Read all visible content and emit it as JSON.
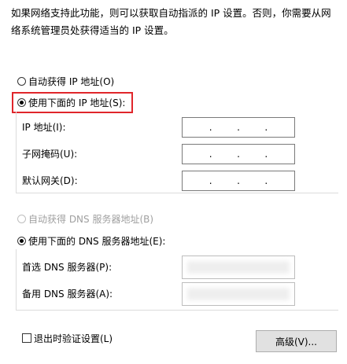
{
  "description": "如果网络支持此功能，则可以获取自动指派的 IP 设置。否则，你需要从网络系统管理员处获得适当的 IP 设置。",
  "ip_options": {
    "auto_label": "自动获得 IP 地址(O)",
    "auto_checked": false,
    "manual_label": "使用下面的 IP 地址(S):",
    "manual_checked": true
  },
  "ip_fields": {
    "ip_address_label": "IP 地址(I):",
    "subnet_mask_label": "子网掩码(U):",
    "gateway_label": "默认网关(D):",
    "dot": "."
  },
  "dns_options": {
    "auto_label": "自动获得 DNS 服务器地址(B)",
    "auto_checked": false,
    "auto_disabled": true,
    "manual_label": "使用下面的 DNS 服务器地址(E):",
    "manual_checked": true
  },
  "dns_fields": {
    "preferred_label": "首选 DNS 服务器(P):",
    "alternate_label": "备用 DNS 服务器(A):"
  },
  "validate_checkbox": {
    "label": "退出时验证设置(L)",
    "checked": false
  },
  "advanced_button": {
    "label": "高级(V)..."
  },
  "colors": {
    "highlight": "#e0262b",
    "disabled_text": "#a0a0a0"
  }
}
